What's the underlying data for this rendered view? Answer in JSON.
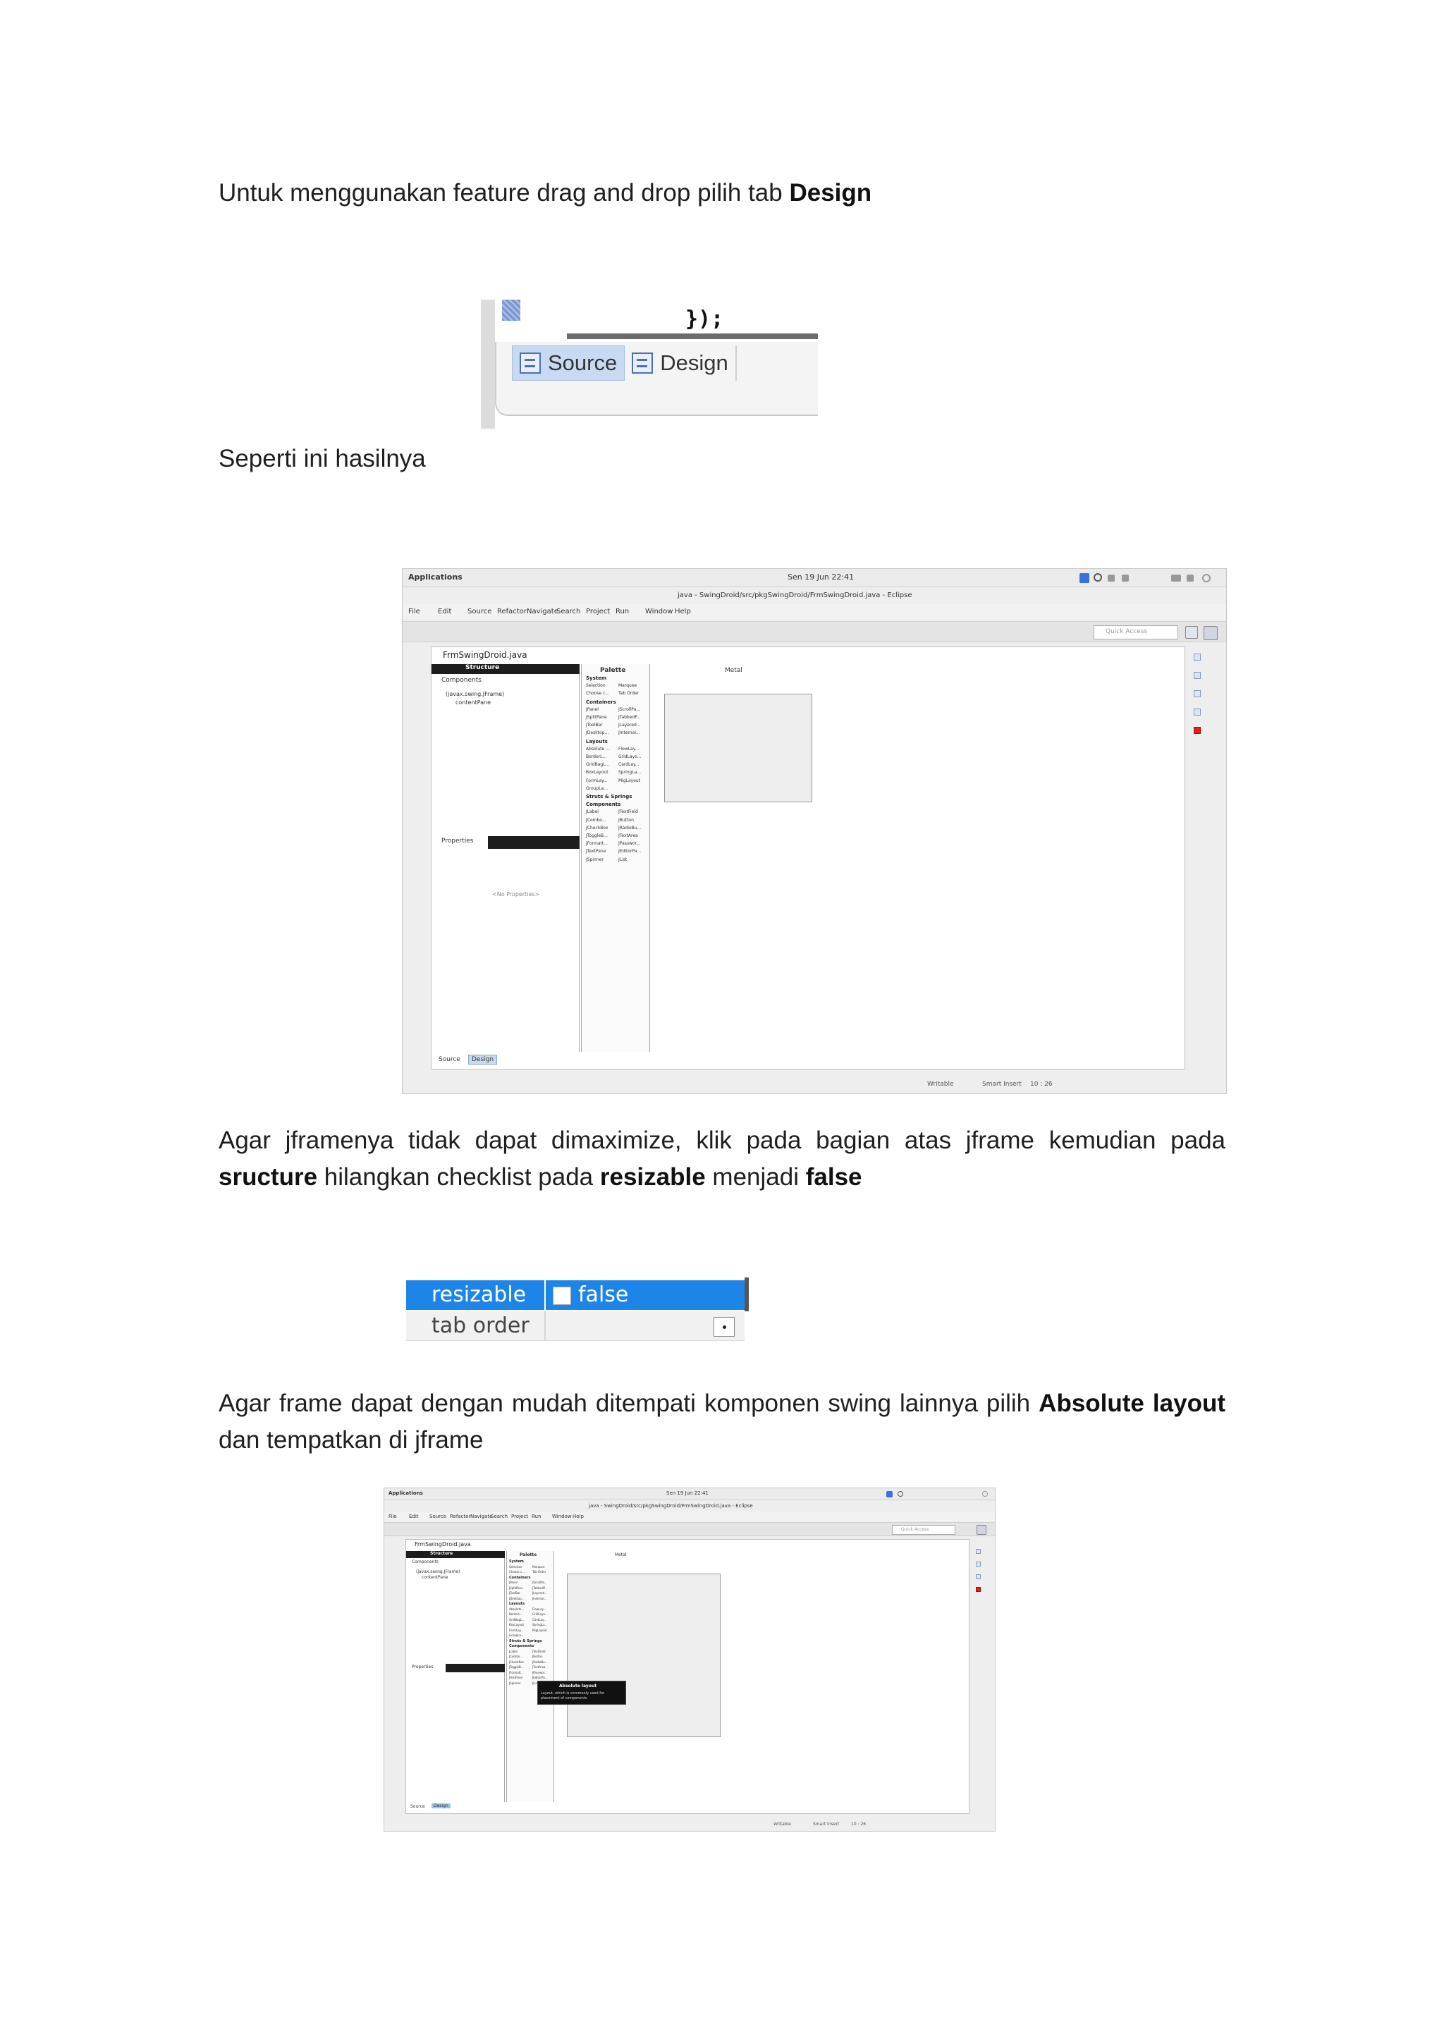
{
  "doc": {
    "para1": {
      "text": "Untuk menggunakan feature drag and drop pilih tab ",
      "bold": "Design"
    },
    "fig1": {
      "code": "});",
      "tab_source": "Source",
      "tab_design": "Design"
    },
    "para2": {
      "text": "Seperti ini hasilnya"
    },
    "para3": {
      "t1": "Agar jframenya tidak dapat dimaximize, klik pada bagian atas jframe kemudian pada ",
      "b1": "sructure",
      "t2": " hilangkan checklist pada ",
      "b2": "resizable",
      "t3": " menjadi ",
      "b3": "false"
    },
    "fig3": {
      "row1_name": "resizable",
      "row1_value": "false",
      "row2_name": "tab order"
    },
    "para4": {
      "t1": "Agar frame dapat dengan mudah ditempati komponen swing lainnya pilih ",
      "b1": "Absolute layout",
      "t2": " dan tempatkan di jframe"
    }
  },
  "eclipse": {
    "sys_apps": "Applications",
    "sys_clock": "Sen 19 Jun 22:41",
    "window_title": "java - SwingDroid/src/pkgSwingDroid/FrmSwingDroid.java - Eclipse",
    "menu": [
      "File",
      "Edit",
      "Source",
      "Refactor",
      "Navigate",
      "Search",
      "Project",
      "Run",
      "Window",
      "Help"
    ],
    "quick_access": "Quick Access",
    "editor_tab": "FrmSwingDroid.java",
    "structure_title": "Structure",
    "components_label": "Components",
    "tree_root": "(javax.swing.JFrame)",
    "tree_child": "contentPane",
    "properties_label": "Properties",
    "no_properties": "<No Properties>",
    "palette_title": "Palette",
    "toolbar_laf": "Metal",
    "palette": [
      {
        "group": "System",
        "items": [
          [
            "Selection",
            "Marquee"
          ],
          [
            "Choose c...",
            "Tab Order"
          ]
        ]
      },
      {
        "group": "Containers",
        "items": [
          [
            "JPanel",
            "JScrollPa..."
          ],
          [
            "JSplitPane",
            "JTabbedP..."
          ],
          [
            "JToolBar",
            "JLayered..."
          ],
          [
            "JDesktop...",
            "JInternal..."
          ]
        ]
      },
      {
        "group": "Layouts",
        "items": [
          [
            "Absolute ...",
            "FlowLay..."
          ],
          [
            "BorderL...",
            "GridLayo..."
          ],
          [
            "GridBagL...",
            "CardLay..."
          ],
          [
            "BoxLayout",
            "SpringLa..."
          ],
          [
            "FormLay...",
            "MigLayout"
          ],
          [
            "GroupLa...",
            ""
          ]
        ]
      },
      {
        "group": "Struts & Springs",
        "items": []
      },
      {
        "group": "Components",
        "items": [
          [
            "JLabel",
            "JTextField"
          ],
          [
            "JCombo...",
            "JButton"
          ],
          [
            "JCheckBox",
            "JRadioBu..."
          ],
          [
            "JToggleB...",
            "JTextArea"
          ],
          [
            "JFormatt...",
            "JPasswor..."
          ],
          [
            "JTextPane",
            "JEditorPa..."
          ],
          [
            "JSpinner",
            "JList"
          ]
        ]
      }
    ],
    "bottom_source": "Source",
    "bottom_design": "Design",
    "status_writable": "Writable",
    "status_insert": "Smart Insert",
    "status_pos": "10 : 26",
    "tooltip_title": "Absolute layout",
    "tooltip_body": "Layout, which is commonly used for placement of components"
  },
  "colors": {
    "selection_blue": "#1e85e8",
    "tab_active": "#c8daf2",
    "status_red": "#e02020"
  }
}
